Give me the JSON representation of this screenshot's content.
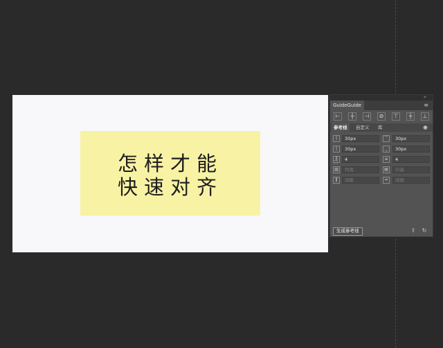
{
  "artboard": {
    "headline_line1": "怎样才能",
    "headline_line2": "快速对齐",
    "card_color": "#f8f2a4",
    "background_color": "#f8f8fa"
  },
  "panel": {
    "collapse_icon": "double-chevron-icon",
    "tab_title": "GuideGuide",
    "menu_icon": "hamburger-icon",
    "tools": [
      "align-left-icon",
      "center-vertical-icon",
      "align-right-icon",
      "clear-guides-icon",
      "align-top-icon",
      "center-horizontal-icon",
      "align-bottom-icon"
    ],
    "sub_tabs": {
      "guides": "参考线",
      "custom": "自定义",
      "library": "库"
    },
    "visibility_icon": "eye-icon",
    "fields": {
      "left_margin": "30px",
      "top_margin": "30px",
      "right_margin": "30px",
      "bottom_margin": "30px",
      "columns": "4",
      "rows": "4",
      "column_width_placeholder": "列宽",
      "row_height_placeholder": "行高",
      "column_gutter_placeholder": "间距",
      "row_gutter_placeholder": "间距"
    },
    "generate_button": "生成参考线",
    "export_icon": "export-icon",
    "reset_icon": "refresh-icon"
  }
}
